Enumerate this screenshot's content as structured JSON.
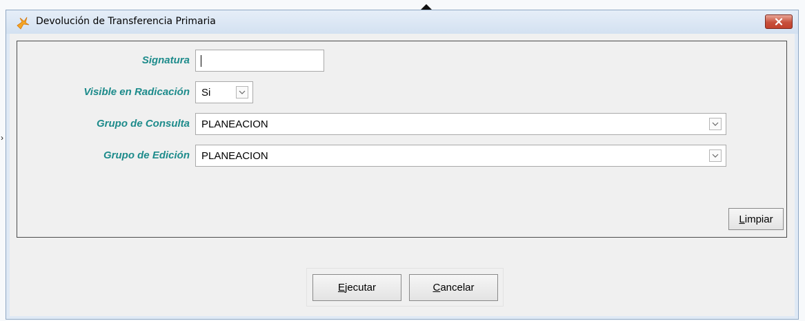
{
  "window": {
    "title": "Devolución de Transferencia Primaria",
    "icon": "app-icon",
    "close_icon": "close-icon"
  },
  "form": {
    "signatura": {
      "label": "Signatura",
      "value": ""
    },
    "visible_radicacion": {
      "label": "Visible en Radicación",
      "value": "Si"
    },
    "grupo_consulta": {
      "label": "Grupo de Consulta",
      "value": "PLANEACION"
    },
    "grupo_edicion": {
      "label": "Grupo de Edición",
      "value": "PLANEACION"
    }
  },
  "buttons": {
    "limpiar": {
      "accel": "L",
      "rest": "impiar"
    },
    "ejecutar": {
      "accel": "E",
      "rest": "jecutar"
    },
    "cancelar": {
      "accel": "C",
      "rest": "ancelar"
    }
  },
  "colors": {
    "label": "#1d8b8b",
    "close": "#c7503b",
    "titlebar": "#d3e1f1"
  }
}
